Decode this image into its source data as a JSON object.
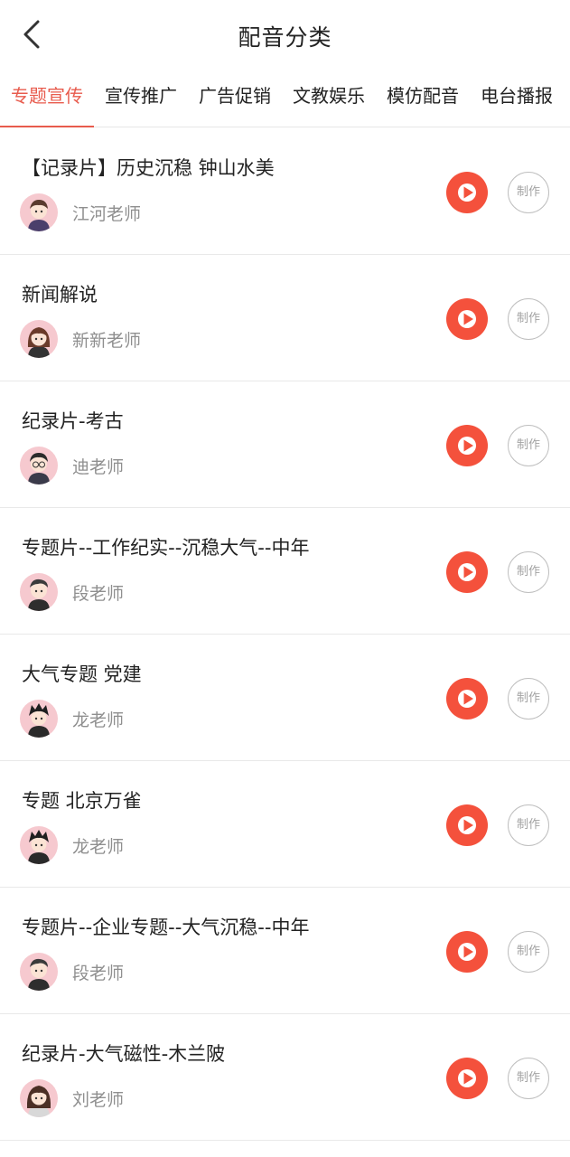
{
  "header": {
    "title": "配音分类",
    "back_icon": "chevron-left-icon"
  },
  "tabs": [
    {
      "label": "专题宣传",
      "active": true
    },
    {
      "label": "宣传推广",
      "active": false
    },
    {
      "label": "广告促销",
      "active": false
    },
    {
      "label": "文教娱乐",
      "active": false
    },
    {
      "label": "模仿配音",
      "active": false
    },
    {
      "label": "电台播报",
      "active": false
    }
  ],
  "colors": {
    "accent": "#e85b4d",
    "play": "#f4513c",
    "avatar_bg": "#f6c9cf"
  },
  "items": [
    {
      "title": "【记录片】历史沉稳  钟山水美",
      "teacher": "江河老师",
      "make_label": "制作"
    },
    {
      "title": "新闻解说",
      "teacher": "新新老师",
      "make_label": "制作"
    },
    {
      "title": "纪录片-考古",
      "teacher": "迪老师",
      "make_label": "制作"
    },
    {
      "title": "专题片--工作纪实--沉稳大气--中年",
      "teacher": "段老师",
      "make_label": "制作"
    },
    {
      "title": "大气专题 党建",
      "teacher": "龙老师",
      "make_label": "制作"
    },
    {
      "title": "专题 北京万雀",
      "teacher": "龙老师",
      "make_label": "制作"
    },
    {
      "title": "专题片--企业专题--大气沉稳--中年",
      "teacher": "段老师",
      "make_label": "制作"
    },
    {
      "title": "纪录片-大气磁性-木兰陂",
      "teacher": "刘老师",
      "make_label": "制作"
    }
  ]
}
